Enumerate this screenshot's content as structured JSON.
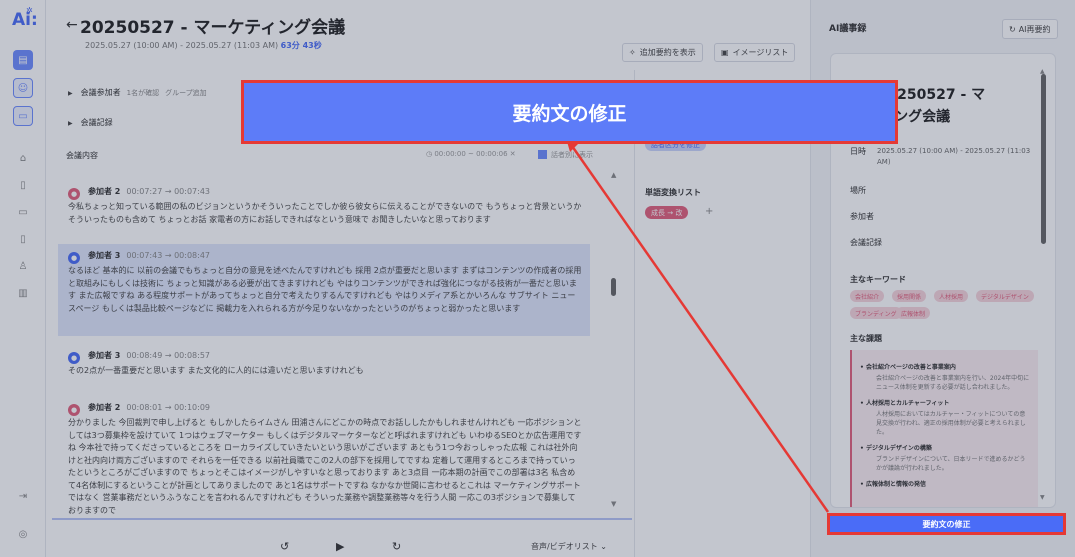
{
  "rail": {
    "logo": "Ai:"
  },
  "header": {
    "back_glyph": "←",
    "title": "20250527 - マーケティング会議",
    "time_range": "2025.05.27 (10:00 AM) - 2025.05.27 (11:03 AM)",
    "duration": "63分 43秒",
    "add_summary": "追加要約を表示",
    "image_list": "イメージリスト"
  },
  "sections": {
    "participants": "会議参加者",
    "participants_sub": "1名が確認",
    "group_add": "グループ追加",
    "minutes": "会議記録"
  },
  "conversation": {
    "heading": "会議内容",
    "time_filter": "00:00:00 ~ 00:00:06",
    "checkbox_label": "話者別に表示",
    "messages": [
      {
        "speaker": "参加者 2",
        "time": "00:07:27 → 00:07:43",
        "text": "今私ちょっと知っている範囲の私のビジョンというかそういったことでしか彼ら彼女らに伝えることができないので もうちょっと背景というかそういったものも含めて ちょっとお話 家電者の方にお話しできればなという意味で お聞きしたいなと思っております",
        "avatar": "pink"
      },
      {
        "speaker": "参加者 3",
        "time": "00:07:43 → 00:08:47",
        "text": "なるほど 基本的に 以前の会議でもちょっと自分の意見を述べたんですけれども 採用 2点が重要だと思います まずはコンテンツの作成者の採用と取組みにもしくは技術に ちょっと知識がある必要が出てきますけれども やはりコンテンツができれば強化につながる技術が一番だと思います また広報ですね ある程度サポートがあってちょっと自分で考えたりするんですけれども やはりメディア系とかいろんな サブサイト ニュースページ もしくは製品比較ページなどに 掲載力を入れられる方が今足りないなかったというのがちょっと弱かったと思います",
        "avatar": "blue"
      },
      {
        "speaker": "参加者 3",
        "time": "00:08:49 → 00:08:57",
        "text": "その2点が一番重要だと思います また文化的に人的には違いだと思いますけれども",
        "avatar": "blue"
      },
      {
        "speaker": "参加者 2",
        "time": "00:08:01 → 00:10:09",
        "text": "分かりました 今回裁判で申し上げると もしかしたらイムさん 田浦さんにどこかの時点でお話ししたかもしれませんけれども 一応ポジションとしては3つ募集枠を設けていて 1つはウェブマーケター もしくはデジタルマーケターなどと呼ばれますけれども いわゆるSEOとか広告運用ですね 今本社で持ってくださっているところを ローカライズしていきたいという思いがございます あともう1つ今おっしゃった広報 これは社外向けと社内向け両方ございますので それらを一任できる 以前社員職でこの2人の部下を採用してですね 定着して運用するところまで持っていったというところがございますので ちょっとそこはイメージがしやすいなと思っております あと3点目 一応本期の計画でこの部署は3名 私含めて4名体制にするということが計画としてありましたので あと1名はサポートですね なかなか世間に言わせるとこれは マーケティングサポートではなく 営業事務だというふうなことを言われるんですけれども そういった業務や調整業務等々を行う人間 一応この3ポジションで募集しておりますので",
        "avatar": "pink"
      }
    ]
  },
  "player": {
    "playlist": "音声/ビデオリスト"
  },
  "middle": {
    "chip_top": "話者区分を修正",
    "word_list_title": "単語変換リスト",
    "word_chip": "成長 → 改"
  },
  "right": {
    "panel_title": "AI議事録",
    "regen": "AI再要約",
    "card_title_l1": "- 20250527 - マ",
    "card_title_l2": "ティング会議",
    "date_label": "日時",
    "date_value": "2025.05.27 (10:00 AM) - 2025.05.27 (11:03 AM)",
    "place_label": "場所",
    "attendees_label": "参加者",
    "minutes_label": "会議記録",
    "keywords_title": "主なキーワード",
    "keywords": [
      "会社紹介",
      "採用関係",
      "人材採用",
      "デジタルデザイン",
      "ブランディング",
      "広報体制"
    ],
    "issues_title": "主な課題",
    "issues": [
      {
        "head": "会社紹介ページの改善と事業案内",
        "body": "会社紹介ページの改善と事業案内を行い、2024年中旬にニュース体制を更新する必要が話し合われました。"
      },
      {
        "head": "人材採用とカルチャーフィット",
        "body": "人材採用においてはカルチャー・フィットについての意見交換が行われ、適正の採用体制が必要と考えられました。"
      },
      {
        "head": "デジタルデザインの構築",
        "body": "ブランドデザインについて、日本リードで進めるかどうかが議論が行われました。"
      },
      {
        "head": "広報体制と情報の発信",
        "body": ""
      }
    ]
  },
  "overlay": {
    "big_button": "要約文の修正",
    "small_button": "要約文の修正"
  },
  "colors": {
    "accent": "#4a6cf7",
    "highlight_red": "#e53935",
    "pink": "#e2607c"
  }
}
